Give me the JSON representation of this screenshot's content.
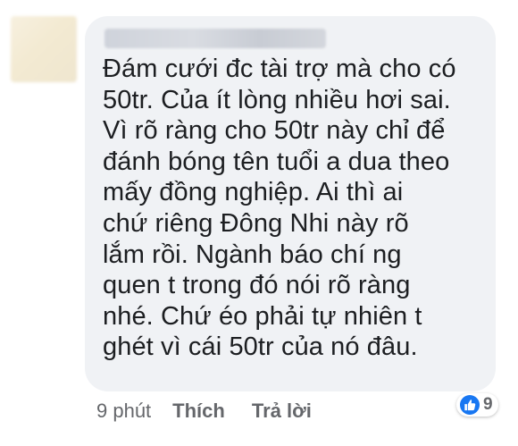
{
  "comment": {
    "author": "",
    "text": "Đám cưới đc tài trợ mà cho có\n50tr. Của ít lòng nhiều hơi sai.\nVì rõ ràng cho 50tr này chỉ để\nđánh bóng tên tuổi a dua theo\nmấy đồng nghiệp. Ai thì ai\nchứ riêng Đông Nhi này rõ\nlắm rồi. Ngành báo chí ng\nquen t trong đó nói rõ ràng\nnhé. Chứ éo phải tự nhiên t\nghét vì cái 50tr của nó đâu.",
    "time": "9 phút",
    "like_label": "Thích",
    "reply_label": "Trả lời",
    "reaction_count": "9",
    "reaction_icon": "like-icon",
    "bubble_color": "#f0f2f5",
    "accent_color": "#1877f2"
  }
}
